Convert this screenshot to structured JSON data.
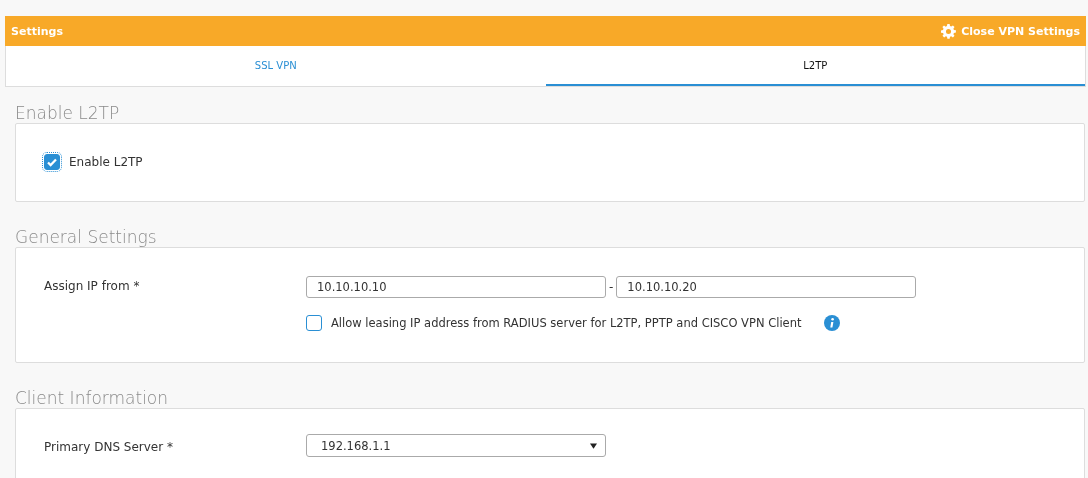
{
  "header": {
    "title": "Settings",
    "action": "Close VPN Settings"
  },
  "tabs": [
    {
      "label": "SSL VPN",
      "selected": false
    },
    {
      "label": "L2TP",
      "selected": true
    }
  ],
  "sections": [
    {
      "title": "Enable L2TP",
      "rows": [
        {
          "kind": "checkbox",
          "label": "Enable L2TP",
          "checked": true
        }
      ]
    },
    {
      "title": "General Settings",
      "rows": [
        {
          "kind": "range",
          "label": "Assign IP from *",
          "from": "10.10.10.10",
          "separator": "-",
          "to": "10.10.10.20"
        },
        {
          "kind": "checkbox-info",
          "label": "Allow leasing IP address from RADIUS server for L2TP, PPTP and CISCO VPN Client",
          "checked": false
        }
      ]
    },
    {
      "title": "Client Information",
      "rows": [
        {
          "kind": "select",
          "label": "Primary DNS Server *",
          "value": "192.168.1.1"
        }
      ]
    }
  ]
}
